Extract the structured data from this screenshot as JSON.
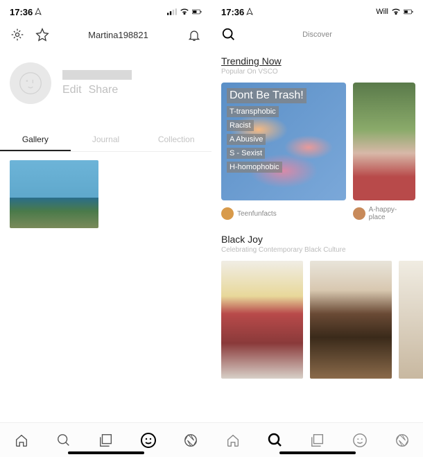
{
  "left": {
    "status": {
      "time": "17:36",
      "carrier": ""
    },
    "header": {
      "username": "Martina198821"
    },
    "profile": {
      "edit": "Edit",
      "share": "Share"
    },
    "tabs": [
      {
        "label": "Gallery",
        "active": true
      },
      {
        "label": "Journal",
        "active": false
      },
      {
        "label": "Collection",
        "active": false
      }
    ]
  },
  "right": {
    "status": {
      "time": "17:36",
      "carrier": "Will"
    },
    "header": {
      "title": "Discover"
    },
    "trending": {
      "title": "Trending Now",
      "subtitle": "Popular On VSCO",
      "card1": {
        "headline": "Dont Be Trash!",
        "lines": [
          "T-transphobic",
          "Racist",
          "A Abusive",
          "S - Sexist",
          "H-homophobic"
        ]
      },
      "authors": [
        {
          "name": "Teenfunfacts",
          "color": "#d89a4a"
        },
        {
          "name": "A-happy-place",
          "color": "#c88a5a"
        }
      ]
    },
    "blackjoy": {
      "title": "Black Joy",
      "subtitle": "Celebrating Contemporary Black Culture"
    }
  }
}
